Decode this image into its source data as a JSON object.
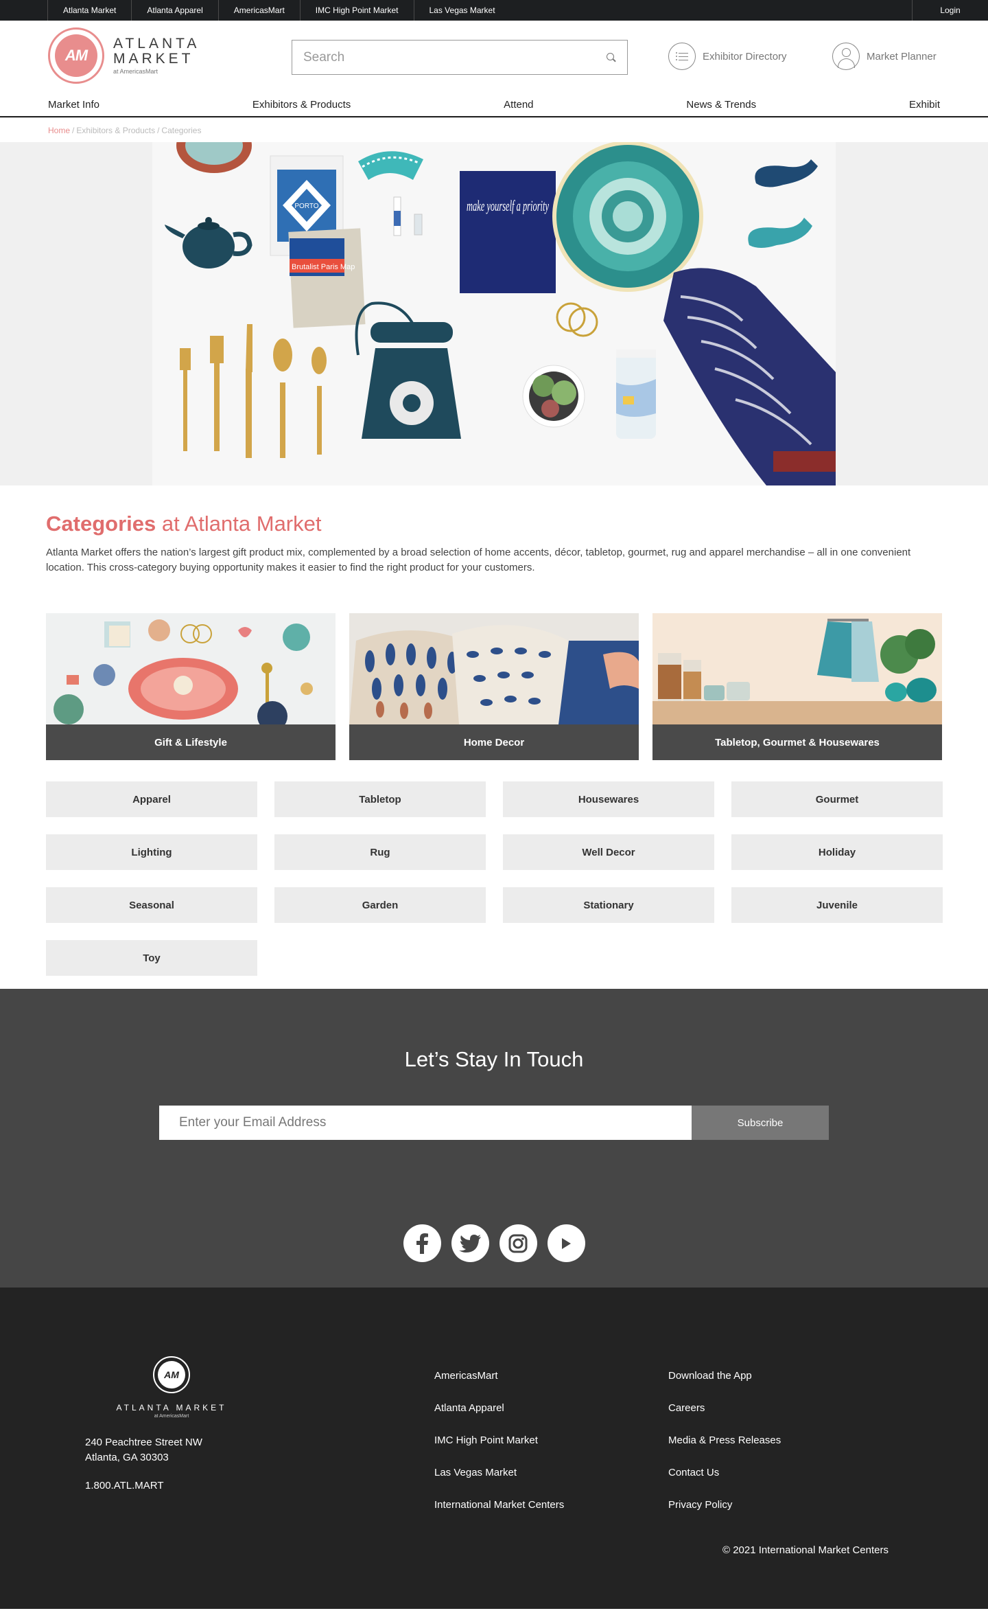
{
  "utility_bar": {
    "links": [
      "Atlanta Market",
      "Atlanta Apparel",
      "AmericasMart",
      "IMC High Point Market",
      "Las Vegas Market"
    ],
    "login": "Login"
  },
  "header": {
    "logo_mark": "AM",
    "logo_line1": "ATLANTA",
    "logo_line2": "MARKET",
    "logo_line3": "at AmericasMart",
    "search_placeholder": "Search",
    "exhibitor_directory": "Exhibitor Directory",
    "market_planner": "Market Planner"
  },
  "nav": {
    "items": [
      "Market Info",
      "Exhibitors & Products",
      "Attend",
      "News & Trends",
      "Exhibit"
    ]
  },
  "breadcrumb": {
    "home": "Home",
    "sep": "/",
    "level2": "Exhibitors & Products",
    "level3": "Categories"
  },
  "hero": {
    "notebook_text": "make yourself a priority",
    "book1": "PORTO",
    "book2": "Brutalist Paris Map"
  },
  "intro": {
    "title_bold": "Categories",
    "title_rest": "at Atlanta Market",
    "body": "Atlanta Market offers the nation’s largest gift product mix, complemented by a broad selection of home accents, décor, tabletop, gourmet, rug and apparel merchandise – all in one convenient location. This cross-category buying opportunity makes it easier to find the right product for your customers."
  },
  "featured_categories": [
    {
      "label": "Gift & Lifestyle"
    },
    {
      "label": "Home Decor"
    },
    {
      "label": "Tabletop, Gourmet & Housewares"
    }
  ],
  "categories": [
    "Apparel",
    "Tabletop",
    "Housewares",
    "Gourmet",
    "Lighting",
    "Rug",
    "Well Decor",
    "Holiday",
    "Seasonal",
    "Garden",
    "Stationary",
    "Juvenile",
    "Toy"
  ],
  "newsletter": {
    "title": "Let’s Stay In Touch",
    "email_placeholder": "Enter your Email Address",
    "subscribe": "Subscribe"
  },
  "social": [
    "facebook-icon",
    "twitter-icon",
    "instagram-icon",
    "youtube-icon"
  ],
  "footer": {
    "logo_mark": "AM",
    "logo_name": "ATLANTA MARKET",
    "logo_sub": "at AmericasMart",
    "address_line1": "240 Peachtree Street NW",
    "address_line2": "Atlanta, GA 30303",
    "phone": "1.800.ATL.MART",
    "col1": [
      "AmericasMart",
      "Atlanta Apparel",
      "IMC High Point Market",
      "Las Vegas Market",
      "International Market Centers"
    ],
    "col2": [
      "Download the App",
      "Careers",
      "Media & Press Releases",
      "Contact Us",
      "Privacy Policy"
    ],
    "copyright": "© 2021 International Market Centers"
  },
  "colors": {
    "brand_coral": "#e88d8d",
    "title_coral": "#e06d6d",
    "dark_bar": "#1d1f21",
    "newsletter_bg": "#464646",
    "footer_bg": "#232323"
  }
}
